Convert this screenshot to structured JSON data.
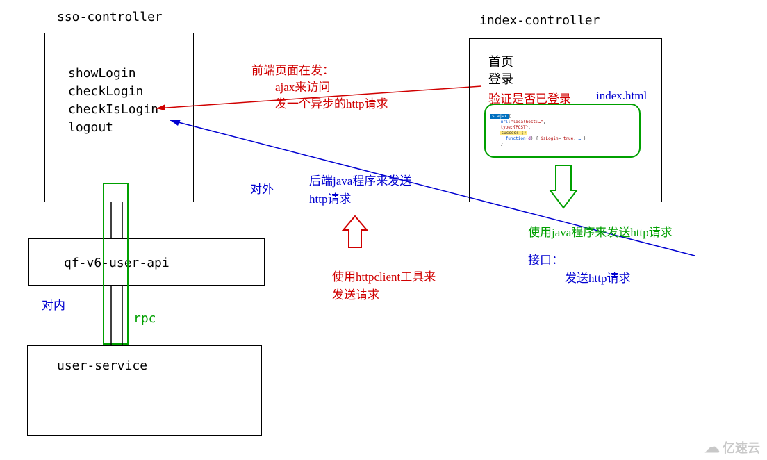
{
  "sso": {
    "title": "sso-controller",
    "methods": [
      "showLogin",
      "checkLogin",
      "checkIsLogin",
      "logout"
    ]
  },
  "api": {
    "title": "qf-v6-user-api"
  },
  "userService": {
    "title": "user-service"
  },
  "index": {
    "title": "index-controller",
    "items": {
      "home": "首页",
      "login": "登录",
      "verify": "验证是否已登录",
      "file": "index.html"
    }
  },
  "annotations": {
    "frontend1": "前端页面在发：",
    "frontend2": "ajax来访问",
    "frontend3": "发一个异步的http请求",
    "backend1": "后端java程序来发送",
    "backend2": "http请求",
    "httpclient1": "使用httpclient工具来",
    "httpclient2": "发送请求",
    "java_send": "使用java程序来发送http请求",
    "interface_label": "接口：",
    "send_http": "发送http请求",
    "external": "对外",
    "internal": "对内",
    "rpc": "rpc"
  },
  "watermark": "亿速云"
}
